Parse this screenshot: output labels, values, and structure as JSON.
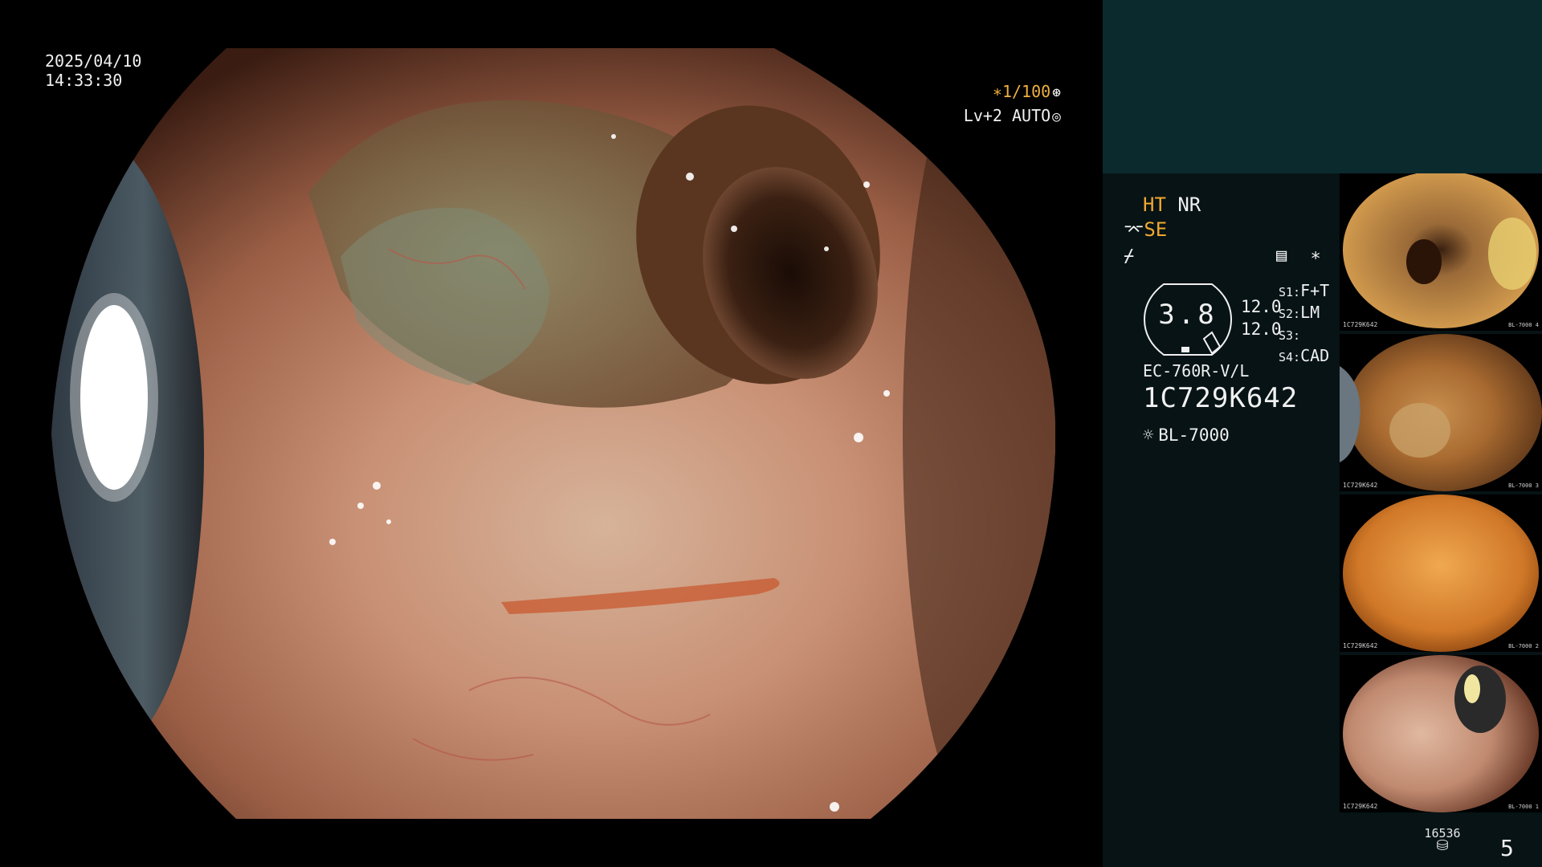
{
  "viewport": {
    "date": "2025/04/10",
    "time": "14:33:30",
    "shutter": "∗1/100",
    "shutter_icon": "⊛",
    "level": "Lv+2 AUTO",
    "level_icon": "◎"
  },
  "panel": {
    "mode_ht": "HT",
    "mode_nr": "NR",
    "se_glyph": "⌤",
    "se": "SE",
    "freeze_glyph": "⌿",
    "memo_icons": "▤ ∗",
    "gauge_value": "3.8",
    "gain_1": "12.0",
    "gain_2": "12.0",
    "settings": [
      {
        "key": "S1:",
        "value": "F+T"
      },
      {
        "key": "S2:",
        "value": "LM"
      },
      {
        "key": "S3:",
        "value": ""
      },
      {
        "key": "S4:",
        "value": "CAD"
      }
    ],
    "scope_model": "EC-760R-V/L",
    "serial": "1C729K642",
    "light_icon": "☼",
    "light_source": "BL-7000"
  },
  "thumbnails": [
    {
      "label": "1C729K642",
      "meta": "BL-7000  4"
    },
    {
      "label": "1C729K642",
      "meta": "BL-7000  3"
    },
    {
      "label": "1C729K642",
      "meta": "BL-7000  2"
    },
    {
      "label": "1C729K642",
      "meta": "BL-7000  1"
    }
  ],
  "footer": {
    "storage_count": "16536",
    "disk_icon": "⛁",
    "page_number": "5"
  },
  "colors": {
    "accent_orange": "#f0a830",
    "panel_bg": "#071315",
    "panel_top_bg": "#0b2a2d"
  }
}
